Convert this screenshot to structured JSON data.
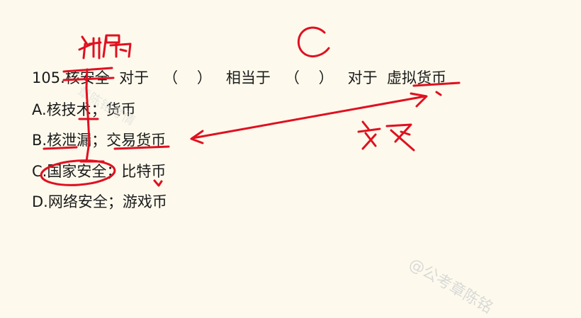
{
  "question": {
    "number_and_term": "105.核安全",
    "duizhi_1": "对于",
    "blank_1": "（    ）",
    "xiangdangyu": "相当于",
    "blank_2": "（    ）",
    "duizhi_2": "对于",
    "term_2": "虚拟货币"
  },
  "options": [
    {
      "id": "A",
      "text": "A.核技术；货币"
    },
    {
      "id": "B",
      "text": "B.核泄漏；交易货币"
    },
    {
      "id": "C",
      "text": "C.国家安全；比特币"
    },
    {
      "id": "D",
      "text": "D.网络安全；游戏币"
    }
  ],
  "watermark": "@公考章陈铭",
  "faint_watermark": "章陈铭考情",
  "annotations": {
    "answer": "C",
    "note_top": "种属",
    "note_right": "交叉"
  },
  "colors": {
    "background": "#fdfaed",
    "text": "#1a1a1a",
    "ink": "#e01020",
    "watermark": "#d6d6d6"
  }
}
